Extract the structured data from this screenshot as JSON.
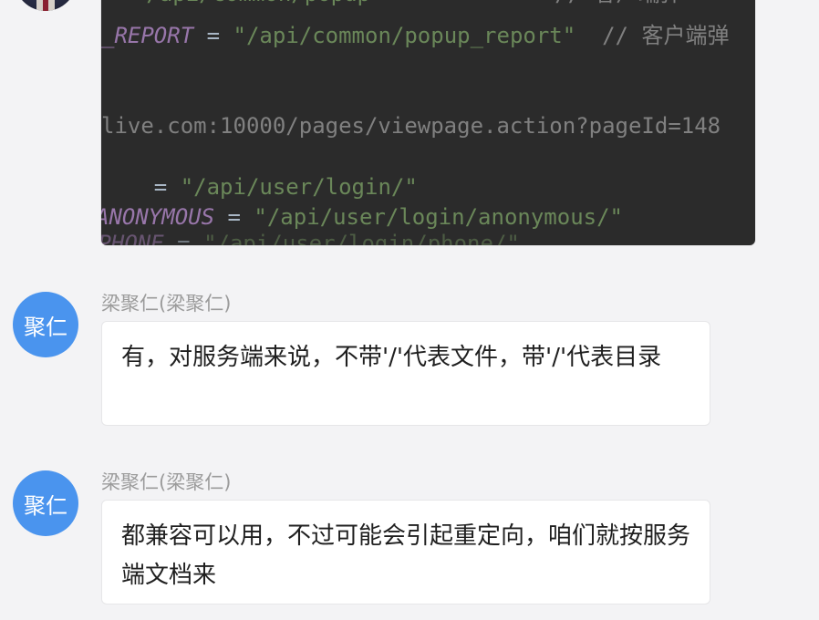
{
  "code_snippet": {
    "lines": [
      {
        "parts": [
          {
            "t": "= ",
            "c": "op"
          },
          {
            "t": "\"/api/common/popup\"",
            "c": "str"
          },
          {
            "t": "             // 客户端弹",
            "c": "cmt"
          }
        ]
      },
      {
        "parts": [
          {
            "t": "_REPORT",
            "c": "kw"
          },
          {
            "t": " = ",
            "c": "op"
          },
          {
            "t": "\"/api/common/popup_report\"",
            "c": "str"
          },
          {
            "t": "  // 客户端弹",
            "c": "cmt"
          }
        ]
      },
      {
        "parts": [
          {
            "t": "live.com:10000/pages/viewpage.action?pageId=148",
            "c": "cmt"
          }
        ]
      },
      {
        "parts": [
          {
            "t": "    = ",
            "c": "op"
          },
          {
            "t": "\"/api/user/login/\"",
            "c": "str"
          }
        ]
      },
      {
        "parts": [
          {
            "t": "ANONYMOUS",
            "c": "kw"
          },
          {
            "t": " = ",
            "c": "op"
          },
          {
            "t": "\"/api/user/login/anonymous/\"",
            "c": "str"
          }
        ]
      },
      {
        "parts": [
          {
            "t": "_PHONE",
            "c": "kw"
          },
          {
            "t": " = ",
            "c": "op"
          },
          {
            "t": "\"/api/user/login/phone/\"",
            "c": "str"
          }
        ]
      }
    ]
  },
  "messages": [
    {
      "avatar_text": "聚仁",
      "sender": "梁聚仁(梁聚仁)",
      "text": "有，对服务端来说，不带'/'代表文件，带'/'代表目录"
    },
    {
      "avatar_text": "聚仁",
      "sender": "梁聚仁(梁聚仁)",
      "text": "都兼容可以用，不过可能会引起重定向，咱们就按服务端文档来"
    }
  ],
  "colors": {
    "background": "#f3f3f5",
    "avatar_blue": "#4a94ee",
    "bubble_bg": "#ffffff",
    "sender_text": "#9b9b9b",
    "code_bg": "#2b2b2b"
  }
}
